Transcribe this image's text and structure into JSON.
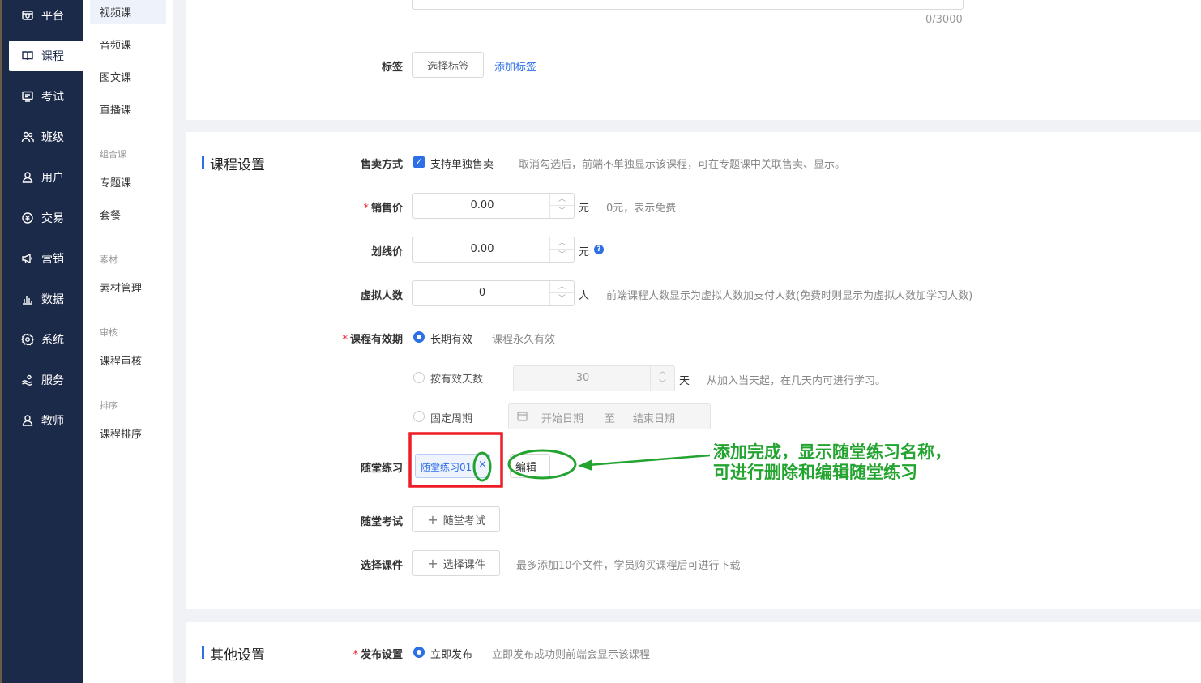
{
  "nav": {
    "items": [
      {
        "label": "平台",
        "icon": "store-icon"
      },
      {
        "label": "课程",
        "icon": "book-icon"
      },
      {
        "label": "考试",
        "icon": "exam-icon"
      },
      {
        "label": "班级",
        "icon": "class-icon"
      },
      {
        "label": "用户",
        "icon": "user-icon"
      },
      {
        "label": "交易",
        "icon": "currency-icon"
      },
      {
        "label": "营销",
        "icon": "megaphone-icon"
      },
      {
        "label": "数据",
        "icon": "bar-chart-icon"
      },
      {
        "label": "系统",
        "icon": "gear-icon"
      },
      {
        "label": "服务",
        "icon": "service-icon"
      },
      {
        "label": "教师",
        "icon": "teacher-icon"
      }
    ],
    "active": "课程"
  },
  "subnav": {
    "video": "视频课",
    "audio": "音频课",
    "article": "图文课",
    "live": "直播课",
    "group_combo": "组合课",
    "topic": "专题课",
    "package": "套餐",
    "group_material": "素材",
    "material_manage": "素材管理",
    "group_review": "审核",
    "course_review": "课程审核",
    "group_sort": "排序",
    "course_sort": "课程排序"
  },
  "top": {
    "counter": "0/3000",
    "tag_label": "标签",
    "select_tag": "选择标签",
    "add_tag": "添加标签"
  },
  "course_settings": {
    "title": "课程设置",
    "sale_mode_label": "售卖方式",
    "sale_mode_option": "支持单独售卖",
    "sale_mode_hint": "取消勾选后，前端不单独显示该课程，可在专题课中关联售卖、显示。",
    "price_label": "销售价",
    "price_value": "0.00",
    "unit_yuan": "元",
    "price_hint": "0元，表示免费",
    "strike_label": "划线价",
    "strike_value": "0.00",
    "virtual_label": "虚拟人数",
    "virtual_value": "0",
    "unit_person": "人",
    "virtual_hint": "前端课程人数显示为虚拟人数加支付人数(免费时则显示为虚拟人数加学习人数)",
    "validity_label": "课程有效期",
    "validity_long": "长期有效",
    "validity_long_hint": "课程永久有效",
    "validity_days": "按有效天数",
    "days_value": "30",
    "unit_day": "天",
    "days_hint": "从加入当天起，在几天内可进行学习。",
    "validity_fixed": "固定周期",
    "start_date": "开始日期",
    "date_to": "至",
    "end_date": "结束日期",
    "exercise_label": "随堂练习",
    "exercise_tag": "随堂练习01",
    "exercise_remove": "×",
    "exercise_edit": "编辑",
    "exam_label": "随堂考试",
    "exam_button": "随堂考试",
    "courseware_label": "选择课件",
    "courseware_button": "选择课件",
    "courseware_hint": "最多添加10个文件，学员购买课程后可进行下载"
  },
  "other_settings": {
    "title": "其他设置",
    "publish_label": "发布设置",
    "publish_option": "立即发布",
    "publish_hint": "立即发布成功则前端会显示该课程"
  },
  "annotation": {
    "line1": "添加完成，显示随堂练习名称，",
    "line2": "可进行删除和编辑随堂练习",
    "red": "#ee1c25",
    "green": "#23a32f"
  }
}
